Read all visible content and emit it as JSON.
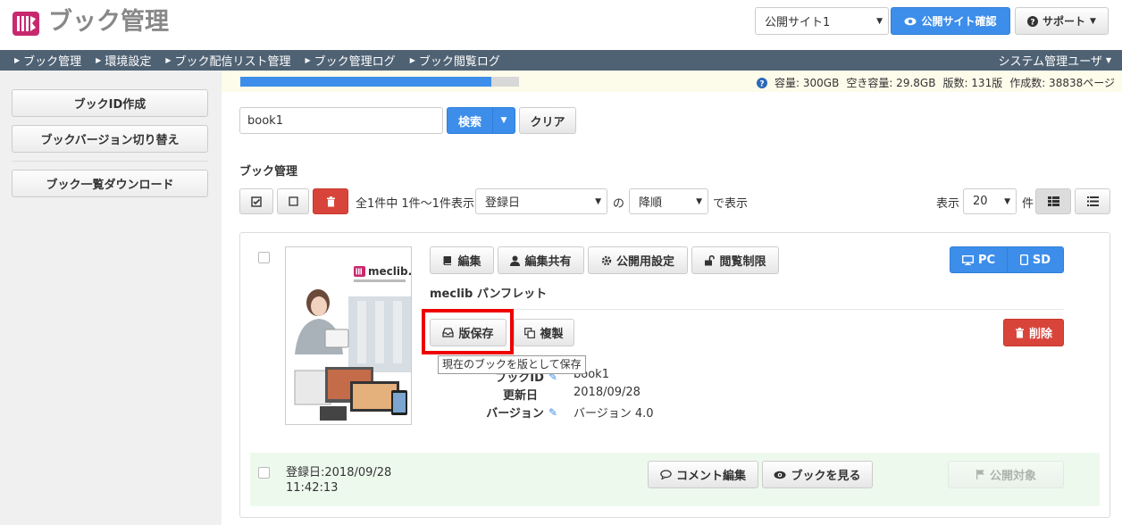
{
  "header": {
    "title": "ブック管理",
    "site_select": "公開サイト1",
    "confirm_button": "公開サイト確認",
    "support_button": "サポート"
  },
  "nav": {
    "items": [
      "ブック管理",
      "環境設定",
      "ブック配信リスト管理",
      "ブック管理ログ",
      "ブック閲覧ログ"
    ],
    "user_menu": "システム管理ユーザ"
  },
  "storage": {
    "used_fraction": 0.9,
    "capacity_text": "容量: 300GB",
    "free_text": "空き容量: 29.8GB",
    "editions_text": "版数: 131版",
    "pages_text": "作成数: 38838ページ"
  },
  "sidebar": {
    "create_id": "ブックID作成",
    "switch_version": "ブックバージョン切り替え",
    "download_list": "ブック一覧ダウンロード"
  },
  "search": {
    "value": "book1",
    "search_button": "検索",
    "clear_button": "クリア"
  },
  "list": {
    "section_title": "ブック管理",
    "count_text": "全1件中 1件〜1件表示",
    "sort_field": "登録日",
    "sort_conj": "の",
    "sort_order": "降順",
    "sort_suffix": "で表示",
    "per_page_label": "表示",
    "per_page": "20",
    "per_page_unit": "件"
  },
  "book": {
    "title": "meclib パンフレット",
    "thumb_logo": "meclib.",
    "buttons": {
      "edit": "編集",
      "edit_share": "編集共有",
      "publish_settings": "公開用設定",
      "view_restrict": "閲覧制限",
      "pc": "PC",
      "sd": "SD",
      "save_edition": "版保存",
      "duplicate": "複製",
      "delete": "削除"
    },
    "tooltip": "現在のブックを版として保存",
    "fields": {
      "book_id_label": "ブックID",
      "book_id": "book1",
      "updated_label": "更新日",
      "updated": "2018/09/28",
      "version_label": "バージョン",
      "version": "バージョン 4.0"
    },
    "footer": {
      "registered": "登録日:2018/09/28",
      "registered_time": "11:42:13",
      "comment_edit": "コメント編集",
      "view_book": "ブックを見る",
      "publish_target": "公開対象"
    }
  },
  "colors": {
    "accent_blue": "#3d8eea",
    "nav_bg": "#4f6274",
    "danger": "#d9443a",
    "logo_magenta": "#c8296e",
    "footer_green": "#eef9ee",
    "highlight_red": "#ee0000"
  }
}
